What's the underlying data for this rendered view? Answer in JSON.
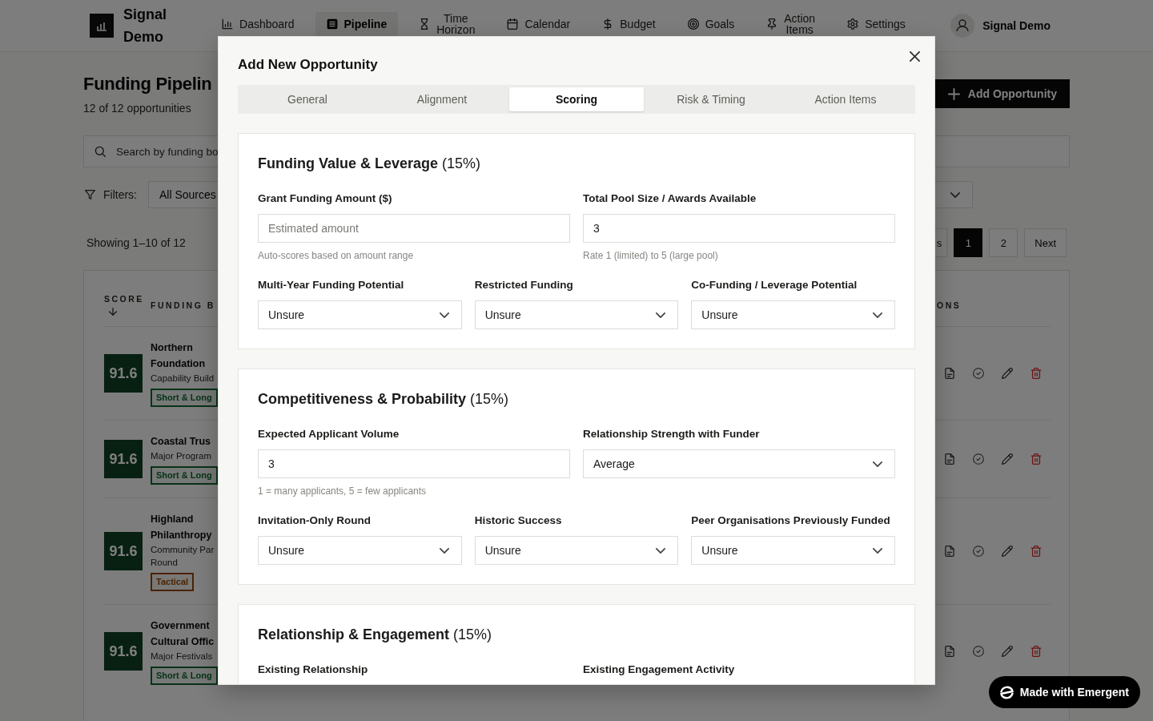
{
  "nav": {
    "brand": "Signal Demo",
    "items": [
      {
        "label": "Dashboard",
        "selected": false
      },
      {
        "label": "Pipeline",
        "selected": true
      },
      {
        "label": "Time Horizon",
        "selected": false
      },
      {
        "label": "Calendar",
        "selected": false
      },
      {
        "label": "Budget",
        "selected": false
      },
      {
        "label": "Goals",
        "selected": false
      },
      {
        "label": "Action Items",
        "selected": false
      },
      {
        "label": "Settings",
        "selected": false
      }
    ],
    "user": "Signal Demo"
  },
  "page": {
    "title": "Funding Pipelin",
    "subtitle": "12 of 12 opportunities",
    "add_button": "Add Opportunity",
    "search": {
      "placeholder": "Search by funding bo"
    },
    "filters": {
      "label": "Filters:",
      "source": "All Sources"
    },
    "results": "Showing 1–10 of 12",
    "pagination": [
      {
        "kind": "prev",
        "label": "s",
        "selected": false
      },
      {
        "kind": "page",
        "label": "1",
        "selected": true
      },
      {
        "kind": "page",
        "label": "2",
        "selected": false
      },
      {
        "kind": "next",
        "label": "Next",
        "selected": false
      }
    ],
    "table": {
      "columns": [
        {
          "label": "SCORE",
          "sorted": true
        },
        {
          "label": "FUNDING B",
          "sorted": false
        },
        {
          "label": "ONS",
          "sorted": false
        }
      ],
      "rows": [
        {
          "score": "91.6",
          "name": "Northern Foundation",
          "subtitle": "Capability Build",
          "tag": {
            "label": "Short & Long",
            "color": "#083318"
          }
        },
        {
          "score": "91.6",
          "name": "Coastal Trus",
          "subtitle": "Major Program",
          "tag": {
            "label": "Short & Long",
            "color": "#083318"
          }
        },
        {
          "score": "91.6",
          "name": "Highland Philanthropy",
          "subtitle": "Community Par\nRound",
          "tag": {
            "label": "Tactical",
            "color": "#4a2204"
          }
        },
        {
          "score": "91.6",
          "name": "Government Cultural Offic",
          "subtitle": "Major Festivals",
          "tag": {
            "label": "Short & Long",
            "color": "#083318"
          }
        }
      ]
    }
  },
  "modal": {
    "title": "Add New Opportunity",
    "tabs": [
      {
        "label": "General",
        "selected": false
      },
      {
        "label": "Alignment",
        "selected": false
      },
      {
        "label": "Scoring",
        "selected": true
      },
      {
        "label": "Risk & Timing",
        "selected": false
      },
      {
        "label": "Action Items",
        "selected": false
      }
    ],
    "sections": [
      {
        "heading": "**Funding Value & Leverage** (15%)",
        "rows": [
          [
            {
              "kind": "input",
              "label": "Grant Funding Amount ($)",
              "placeholder": "Estimated amount",
              "hint": "Auto-scores based on amount range"
            },
            {
              "kind": "input",
              "label": "Total Pool Size / Awards Available",
              "value": "3",
              "hint": "Rate 1 (limited) to 5 (large pool)"
            }
          ],
          [
            {
              "kind": "select",
              "label": "Multi-Year Funding Potential",
              "value": "Unsure"
            },
            {
              "kind": "select",
              "label": "Restricted Funding",
              "value": "Unsure"
            },
            {
              "kind": "select",
              "label": "Co-Funding / Leverage Potential",
              "value": "Unsure"
            }
          ]
        ]
      },
      {
        "heading": "**Competitiveness & Probability** (15%)",
        "rows": [
          [
            {
              "kind": "input",
              "label": "Expected Applicant Volume",
              "value": "3",
              "hint": "1 = many applicants, 5 = few applicants"
            },
            {
              "kind": "select",
              "label": "Relationship Strength with Funder",
              "value": "Average"
            }
          ],
          [
            {
              "kind": "select",
              "label": "Invitation-Only Round",
              "value": "Unsure"
            },
            {
              "kind": "select",
              "label": "Historic Success",
              "value": "Unsure"
            },
            {
              "kind": "select",
              "label": "Peer Organisations Previously Funded",
              "value": "Unsure"
            }
          ]
        ]
      },
      {
        "heading": "**Relationship & Engagement** (15%)",
        "rows": [
          [
            {
              "label": "Existing Relationship"
            },
            {
              "label": "Existing Engagement Activity"
            }
          ]
        ]
      }
    ]
  },
  "badge": {
    "label": "Made with Emergent"
  }
}
